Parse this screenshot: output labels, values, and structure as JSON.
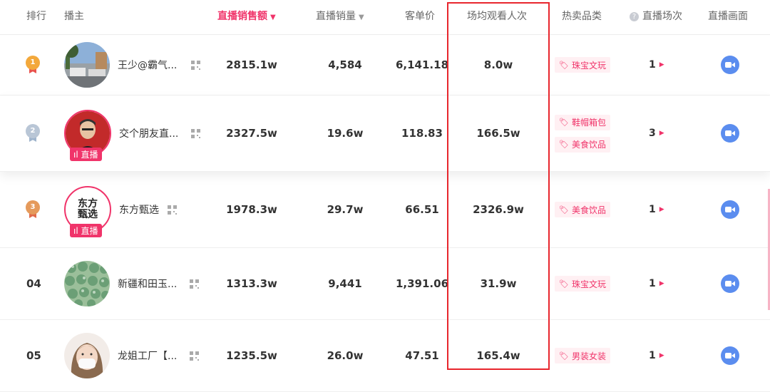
{
  "header": {
    "rank": "排行",
    "anchor": "播主",
    "sales_amount": "直播销售额",
    "sales_volume": "直播销量",
    "unit_price": "客单价",
    "avg_viewers": "场均观看人次",
    "hot_category": "热卖品类",
    "sessions": "直播场次",
    "live_screen": "直播画面",
    "sort_caret": "▼",
    "help_icon": "?"
  },
  "live_badge": "直播",
  "rows": [
    {
      "rank": "1",
      "name": "王少@霸气...",
      "sales": "2815.1w",
      "volume": "4,584",
      "price": "6,141.18",
      "viewers": "8.0w",
      "categories": [
        "珠宝文玩"
      ],
      "sessions": "1",
      "live": false
    },
    {
      "rank": "2",
      "name": "交个朋友直...",
      "sales": "2327.5w",
      "volume": "19.6w",
      "price": "118.83",
      "viewers": "166.5w",
      "categories": [
        "鞋帽箱包",
        "美食饮品"
      ],
      "sessions": "3",
      "live": true
    },
    {
      "rank": "3",
      "name": "东方甄选",
      "sales": "1978.3w",
      "volume": "29.7w",
      "price": "66.51",
      "viewers": "2326.9w",
      "categories": [
        "美食饮品"
      ],
      "sessions": "1",
      "live": true,
      "avatar_text": "东方甄选"
    },
    {
      "rank": "04",
      "name": "新疆和田玉...",
      "sales": "1313.3w",
      "volume": "9,441",
      "price": "1,391.06",
      "viewers": "31.9w",
      "categories": [
        "珠宝文玩"
      ],
      "sessions": "1",
      "live": false
    },
    {
      "rank": "05",
      "name": "龙姐工厂【...",
      "sales": "1235.5w",
      "volume": "26.0w",
      "price": "47.51",
      "viewers": "165.4w",
      "categories": [
        "男装女装"
      ],
      "sessions": "1",
      "live": false
    }
  ],
  "colors": {
    "accent": "#f0346a",
    "highlight_box": "#e8262d",
    "camera_button": "#5b8def",
    "gold": "#f3a83b",
    "silver": "#b9c6d6",
    "bronze": "#e59a5b"
  },
  "icons": {
    "tag": "tag-icon",
    "qr": "qr-code-icon",
    "play": "play-arrow-icon",
    "camera": "video-camera-icon",
    "medal": "medal-icon",
    "bars": "live-bars-icon"
  }
}
